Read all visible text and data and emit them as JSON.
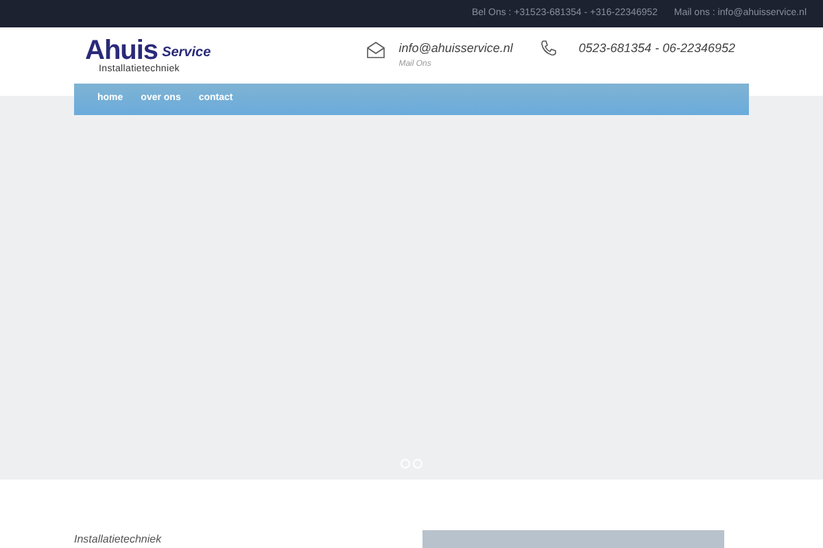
{
  "top_bar": {
    "phone": "Bel Ons : +31523-681354 - +316-22346952",
    "mail": "Mail ons : info@ahuisservice.nl"
  },
  "logo": {
    "brand": "Ahuis",
    "sub": "Service",
    "tagline": "Installatietechniek"
  },
  "contact": {
    "email": "info@ahuisservice.nl",
    "email_label": "Mail Ons",
    "phone": "0523-681354 - 06-22346952"
  },
  "nav": [
    {
      "label": "home"
    },
    {
      "label": "over ons"
    },
    {
      "label": "contact"
    }
  ],
  "slider": {
    "dots": [
      {
        "selected": false
      },
      {
        "selected": false
      }
    ]
  },
  "section": {
    "heading": "Installatietechniek"
  }
}
